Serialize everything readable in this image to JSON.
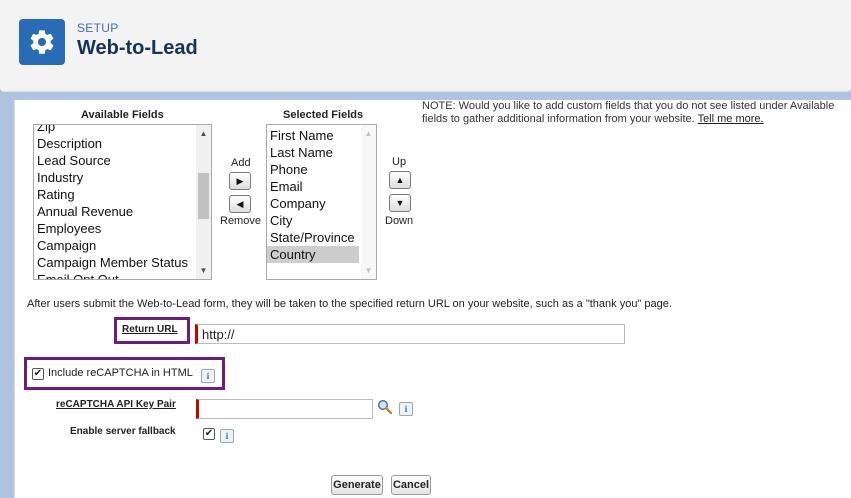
{
  "header": {
    "breadcrumb": "SETUP",
    "title": "Web-to-Lead",
    "icon": "gear-icon"
  },
  "fields": {
    "available_label": "Available Fields",
    "selected_label": "Selected Fields",
    "available_items": [
      "Zip",
      "Description",
      "Lead Source",
      "Industry",
      "Rating",
      "Annual Revenue",
      "Employees",
      "Campaign",
      "Campaign Member Status",
      "Email Opt Out"
    ],
    "selected_items": [
      "First Name",
      "Last Name",
      "Phone",
      "Email",
      "Company",
      "City",
      "State/Province",
      "Country"
    ],
    "selected_highlight": "Country",
    "add_label": "Add",
    "remove_label": "Remove",
    "up_label": "Up",
    "down_label": "Down",
    "note": "NOTE: Would you like to add custom fields that you do not see listed under Available fields to gather additional information from your website.",
    "tell_me_more": "Tell me more."
  },
  "return_url": {
    "help_text": "After users submit the Web-to-Lead form, they will be taken to the specified return URL on your website, such as a \"thank you\" page.",
    "label": "Return URL",
    "value": "http://"
  },
  "recaptcha": {
    "include_label": "Include reCAPTCHA in HTML",
    "include_checked": true,
    "key_pair_label": "reCAPTCHA API Key Pair",
    "key_pair_value": "",
    "fallback_label": "Enable server fallback",
    "fallback_checked": true
  },
  "actions": {
    "generate": "Generate",
    "cancel": "Cancel"
  },
  "colors": {
    "brand_icon": "#2a6bb6",
    "title": "#16325c",
    "highlight_box": "#6b1f7a",
    "required_bar": "#cc0000",
    "background": "#b0c4df"
  }
}
